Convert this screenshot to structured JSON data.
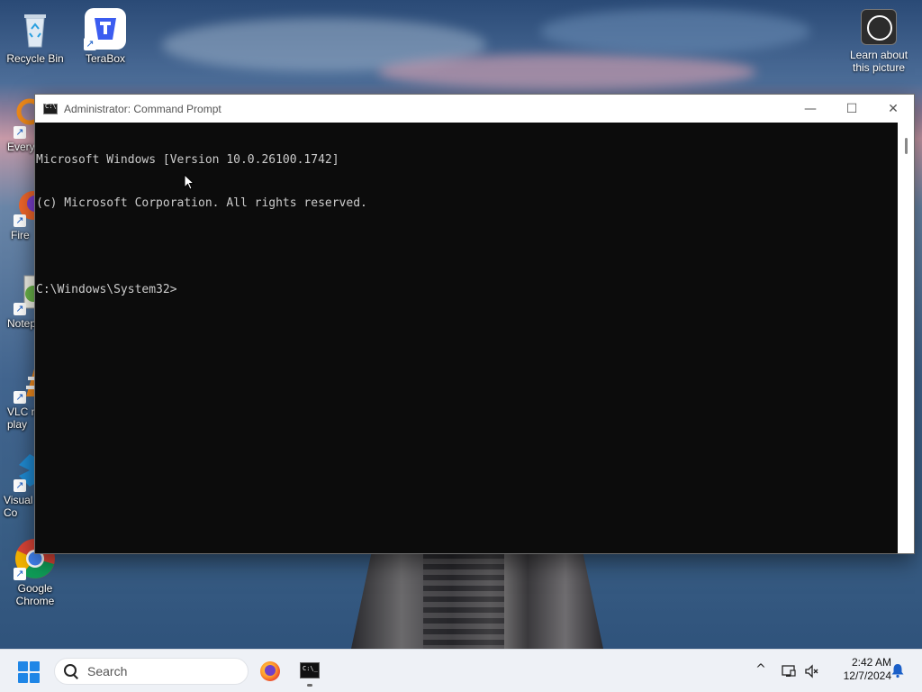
{
  "desktop": {
    "icons": [
      {
        "label": "Recycle Bin"
      },
      {
        "label": "TeraBox"
      },
      {
        "label": "Every"
      },
      {
        "label": "Fire"
      },
      {
        "label": "Notep"
      },
      {
        "label": "VLC m\nplay"
      },
      {
        "label": "Visual\nCo"
      },
      {
        "label": "Google\nChrome"
      }
    ],
    "learn_about": "Learn about\nthis picture"
  },
  "window": {
    "title": "Administrator: Command Prompt",
    "controls": {
      "minimize": "—",
      "maximize": "☐",
      "close": "✕"
    },
    "console_lines": [
      "Microsoft Windows [Version 10.0.26100.1742]",
      "(c) Microsoft Corporation. All rights reserved.",
      "",
      "C:\\Windows\\System32>"
    ]
  },
  "taskbar": {
    "search_placeholder": "Search",
    "time": "2:42 AM",
    "date": "12/7/2024",
    "tray_chevron": "^"
  },
  "colors": {
    "console_bg": "#0c0c0c",
    "console_text": "#cccccc",
    "start_blue": "#1f86e6"
  }
}
